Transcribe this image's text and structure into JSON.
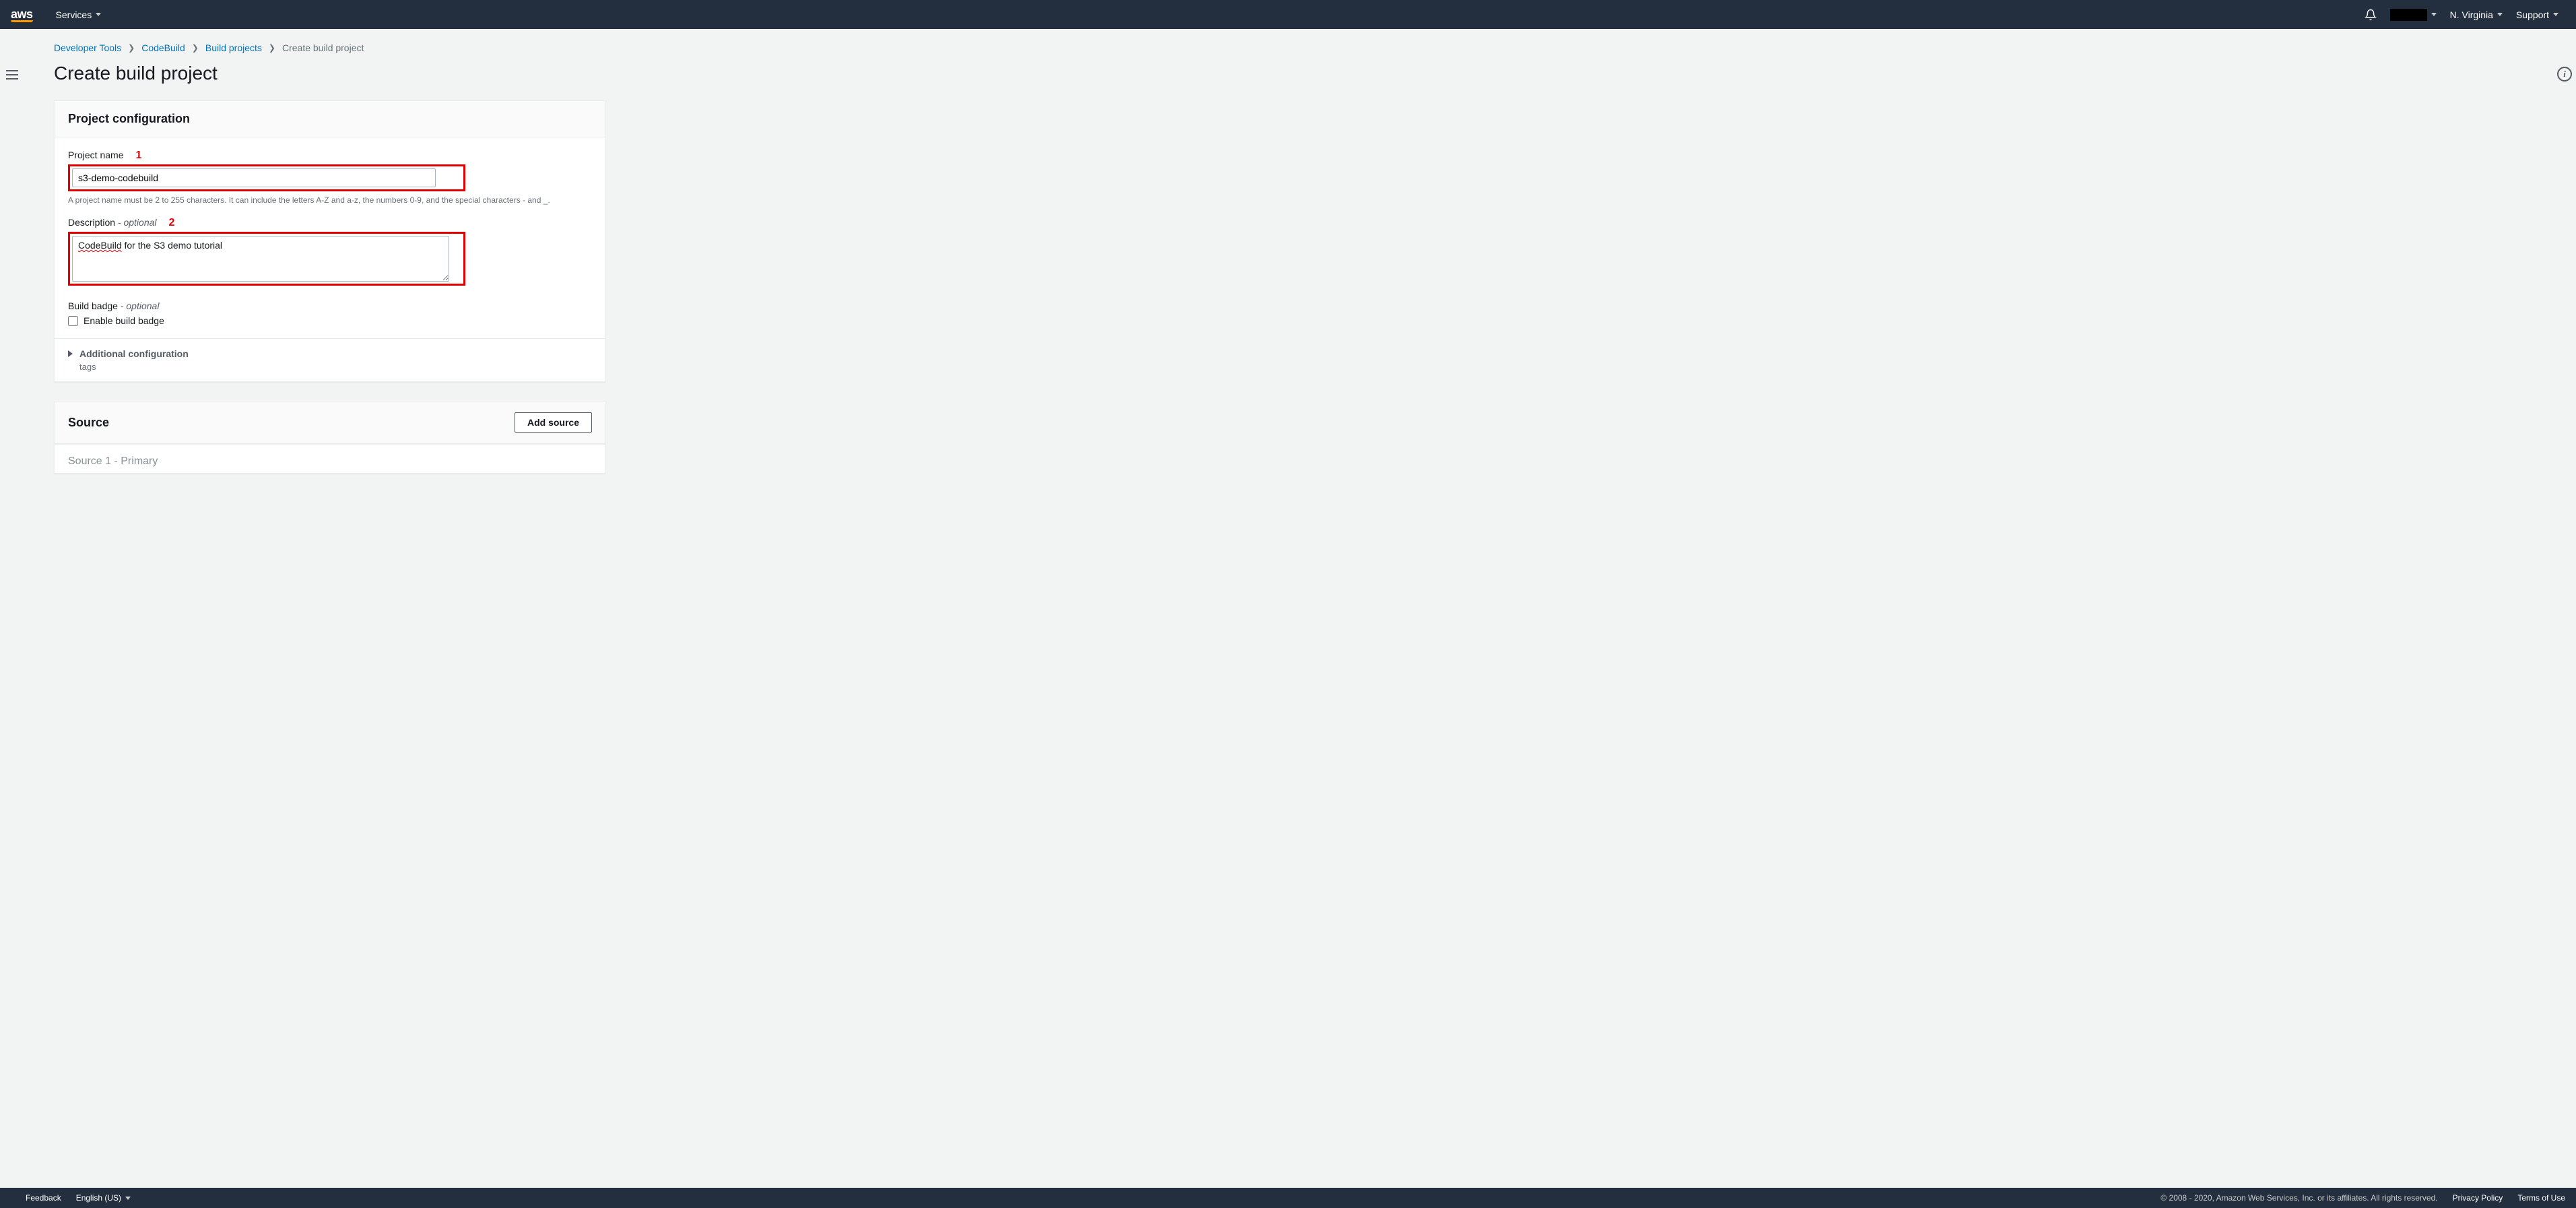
{
  "nav": {
    "logo_text": "aws",
    "services_label": "Services",
    "region_label": "N. Virginia",
    "support_label": "Support"
  },
  "breadcrumb": {
    "items": [
      "Developer Tools",
      "CodeBuild",
      "Build projects"
    ],
    "current": "Create build project"
  },
  "page_title": "Create build project",
  "project_config": {
    "panel_title": "Project configuration",
    "name_label": "Project name",
    "name_value": "s3-demo-codebuild",
    "name_help": "A project name must be 2 to 255 characters. It can include the letters A-Z and a-z, the numbers 0-9, and the special characters - and _.",
    "desc_label": "Description",
    "desc_optional": " - optional",
    "desc_value_prefix": "CodeBuild",
    "desc_value_rest": " for the S3 demo tutorial",
    "badge_label": "Build badge",
    "badge_optional": " - optional",
    "badge_checkbox_label": "Enable build badge",
    "additional_title": "Additional configuration",
    "additional_sub": "tags",
    "annotation1": "1",
    "annotation2": "2"
  },
  "source": {
    "panel_title": "Source",
    "add_button": "Add source",
    "subheading": "Source 1 - Primary"
  },
  "footer": {
    "feedback": "Feedback",
    "language": "English (US)",
    "copyright": "© 2008 - 2020, Amazon Web Services, Inc. or its affiliates. All rights reserved.",
    "privacy": "Privacy Policy",
    "terms": "Terms of Use"
  }
}
